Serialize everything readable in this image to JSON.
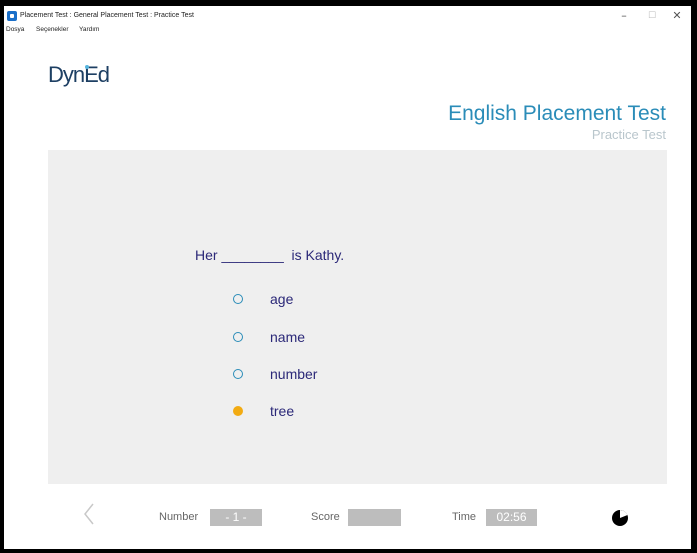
{
  "window": {
    "title": "Placement Test : General Placement Test : Practice Test",
    "controls": {
      "minimize": "–",
      "maximize": "☐",
      "close": "✕"
    }
  },
  "menu": [
    "Dosya",
    "Seçenekler",
    "Yardım"
  ],
  "header": {
    "logo": "DynEd",
    "title": "English Placement Test",
    "subtitle": "Practice Test"
  },
  "question": {
    "text": "Her ________  is Kathy.",
    "options": [
      {
        "label": "age",
        "selected": false
      },
      {
        "label": "name",
        "selected": false
      },
      {
        "label": "number",
        "selected": false
      },
      {
        "label": "tree",
        "selected": true
      }
    ]
  },
  "footer": {
    "number_label": "Number",
    "number_value": "- 1 -",
    "score_label": "Score",
    "score_value": "",
    "time_label": "Time",
    "time_value": "02:56",
    "icons": {
      "back": "chevron-left-icon",
      "timer": "timer-pie-icon"
    }
  },
  "colors": {
    "accent": "#2a8cb8",
    "question_text": "#2b2878",
    "selected_option": "#f2ab12",
    "panel_background": "#efefef"
  }
}
